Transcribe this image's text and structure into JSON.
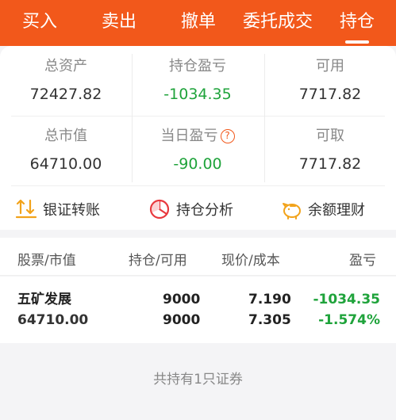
{
  "tabs": [
    "买入",
    "卖出",
    "撤单",
    "委托成交",
    "持仓"
  ],
  "active_tab": "持仓",
  "summary": {
    "total_assets_label": "总资产",
    "total_assets_value": "72427.82",
    "position_pl_label": "持仓盈亏",
    "position_pl_value": "-1034.35",
    "available_label": "可用",
    "available_value": "7717.82",
    "market_value_label": "总市值",
    "market_value_value": "64710.00",
    "daily_pl_label": "当日盈亏",
    "daily_pl_help": "?",
    "daily_pl_value": "-90.00",
    "withdrawable_label": "可取",
    "withdrawable_value": "7717.82"
  },
  "actions": {
    "transfer": "银证转账",
    "analysis": "持仓分析",
    "finance": "余额理财"
  },
  "table": {
    "headers": [
      "股票/市值",
      "持仓/可用",
      "现价/成本",
      "盈亏"
    ],
    "rows": [
      {
        "name": "五矿发展",
        "market_value": "64710.00",
        "position": "9000",
        "available": "9000",
        "price": "7.190",
        "cost": "7.305",
        "pl": "-1034.35",
        "pl_pct": "-1.574%"
      }
    ]
  },
  "footer": "共持有1只证券",
  "colors": {
    "accent": "#f2581b",
    "loss": "#1fa33b"
  }
}
